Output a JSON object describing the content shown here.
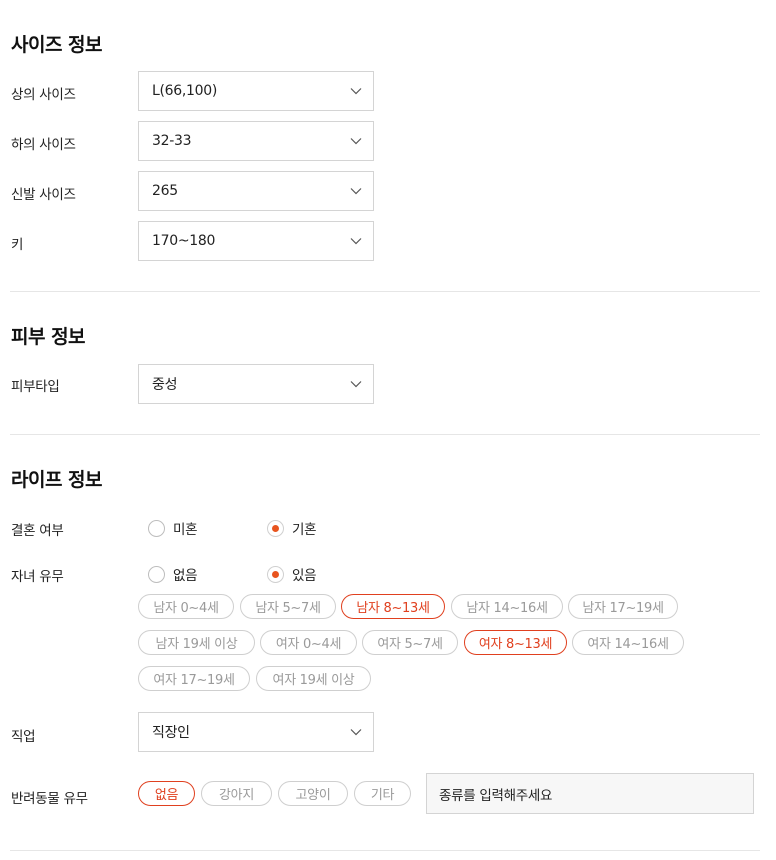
{
  "size_section": {
    "title": "사이즈 정보",
    "top_label": "상의 사이즈",
    "top_value": "L(66,100)",
    "bottom_label": "하의 사이즈",
    "bottom_value": "32-33",
    "shoe_label": "신발 사이즈",
    "shoe_value": "265",
    "height_label": "키",
    "height_value": "170~180"
  },
  "skin_section": {
    "title": "피부 정보",
    "skin_type_label": "피부타입",
    "skin_type_value": "중성"
  },
  "life_section": {
    "title": "라이프 정보",
    "marriage_label": "결혼 여부",
    "marriage_options": [
      "미혼",
      "기혼"
    ],
    "marriage_selected": "기혼",
    "children_label": "자녀 유무",
    "children_options": [
      "없음",
      "있음"
    ],
    "children_selected": "있음",
    "children_chips": [
      {
        "label": "남자 0~4세",
        "selected": false
      },
      {
        "label": "남자 5~7세",
        "selected": false
      },
      {
        "label": "남자 8~13세",
        "selected": true
      },
      {
        "label": "남자 14~16세",
        "selected": false
      },
      {
        "label": "남자 17~19세",
        "selected": false
      },
      {
        "label": "남자 19세 이상",
        "selected": false
      },
      {
        "label": "여자 0~4세",
        "selected": false
      },
      {
        "label": "여자 5~7세",
        "selected": false
      },
      {
        "label": "여자 8~13세",
        "selected": true
      },
      {
        "label": "여자 14~16세",
        "selected": false
      },
      {
        "label": "여자 17~19세",
        "selected": false
      },
      {
        "label": "여자 19세 이상",
        "selected": false
      }
    ],
    "job_label": "직업",
    "job_value": "직장인",
    "pet_label": "반려동물 유무",
    "pet_chips": [
      {
        "label": "없음",
        "selected": true
      },
      {
        "label": "강아지",
        "selected": false
      },
      {
        "label": "고양이",
        "selected": false
      },
      {
        "label": "기타",
        "selected": false
      }
    ],
    "pet_kind_placeholder": "종류를 입력해주세요"
  },
  "colors": {
    "accent": "#e0401f",
    "radio_dot": "#e8541e",
    "chip_border": "#cfcfcf",
    "chip_text": "#9a9a9a"
  },
  "icons": {
    "select_arrow": "chevron-down-icon"
  }
}
